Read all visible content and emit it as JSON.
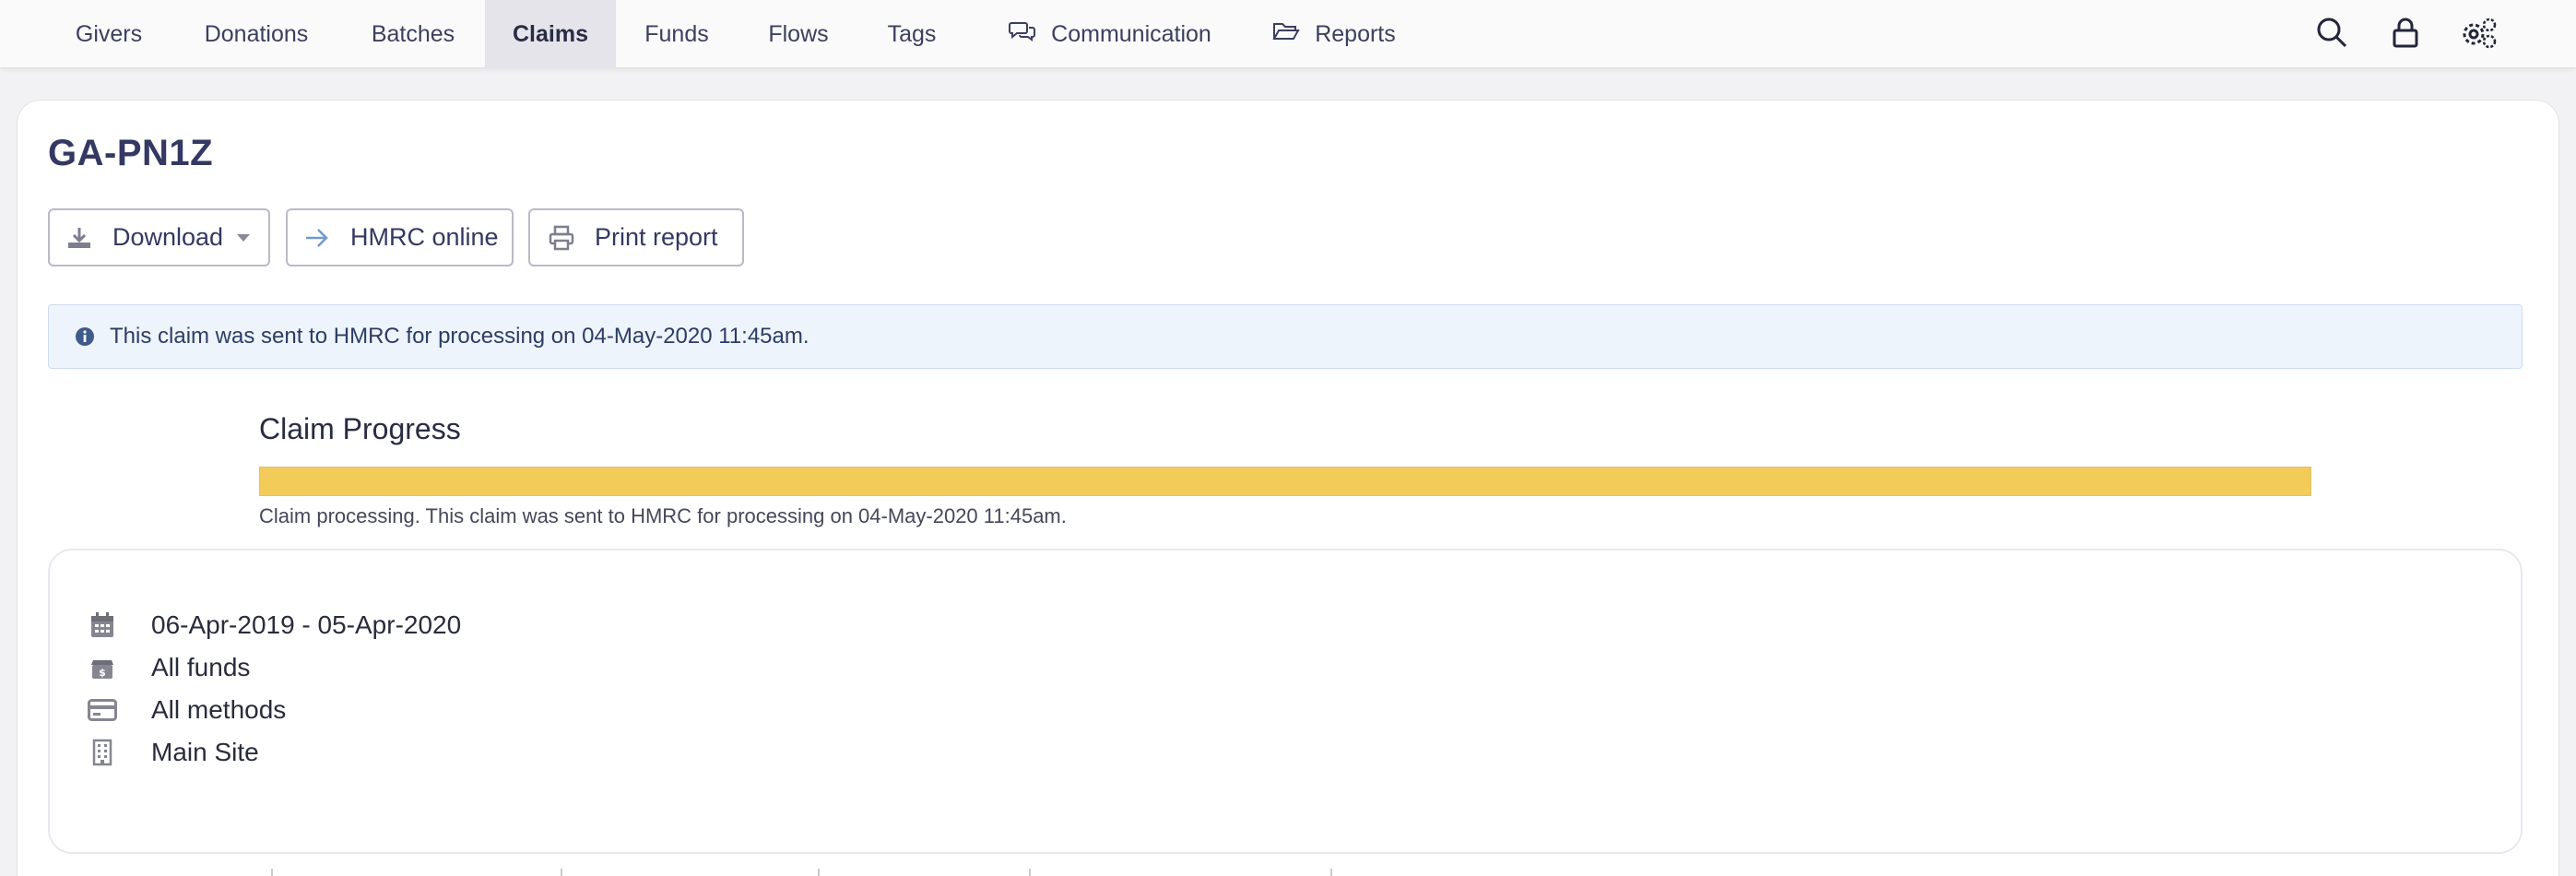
{
  "nav": {
    "items": [
      {
        "label": "Givers"
      },
      {
        "label": "Donations"
      },
      {
        "label": "Batches"
      },
      {
        "label": "Claims",
        "active": true
      },
      {
        "label": "Funds"
      },
      {
        "label": "Flows"
      },
      {
        "label": "Tags"
      },
      {
        "label": "Communication",
        "icon": "chat-bubbles-icon"
      },
      {
        "label": "Reports",
        "icon": "folder-open-icon"
      }
    ],
    "tools": [
      "search-icon",
      "lock-icon",
      "gears-icon"
    ]
  },
  "claim": {
    "title": "GA-PN1Z"
  },
  "actions": {
    "download_label": "Download",
    "hmrc_label": "HMRC online",
    "print_label": "Print report"
  },
  "alert": {
    "text": "This claim was sent to HMRC for processing on 04-May-2020 11:45am."
  },
  "progress": {
    "title": "Claim Progress",
    "percent": 100,
    "status_text": "Claim processing. This claim was sent to HMRC for processing on 04-May-2020 11:45am.",
    "color": "#f3cb59"
  },
  "details": {
    "date_range": "06-Apr-2019 - 05-Apr-2020",
    "funds": "All funds",
    "methods": "All methods",
    "site": "Main Site"
  },
  "colors": {
    "accent": "#343862",
    "nav_active_bg": "#e4e4ea",
    "alert_bg": "#eef4fc",
    "progress": "#f3cb59"
  }
}
